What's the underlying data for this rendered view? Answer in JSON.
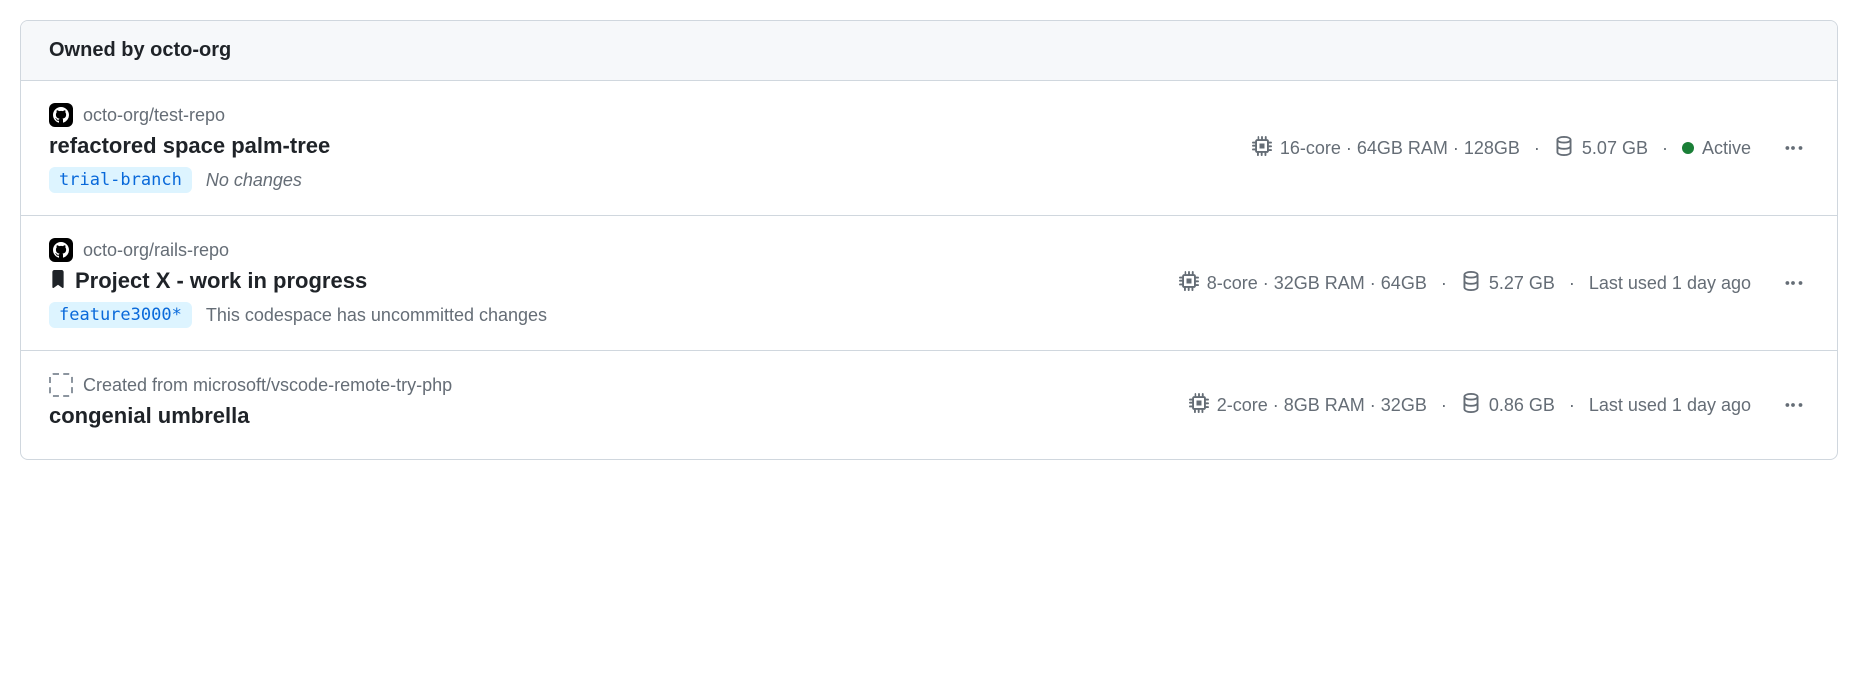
{
  "header": "Owned by octo-org",
  "items": [
    {
      "source_type": "repo",
      "repo_label": "octo-org/test-repo",
      "bookmarked": false,
      "name": "refactored space palm-tree",
      "branch": "trial-branch",
      "changes": "No changes",
      "changes_italic": true,
      "specs": "16-core · 64GB RAM · 128GB",
      "storage": "5.07 GB",
      "status_type": "active",
      "status_text": "Active"
    },
    {
      "source_type": "repo",
      "repo_label": "octo-org/rails-repo",
      "bookmarked": true,
      "name": "Project X - work in progress",
      "branch": "feature3000*",
      "changes": "This codespace has uncommitted changes",
      "changes_italic": false,
      "specs": "8-core · 32GB RAM · 64GB",
      "storage": "5.27 GB",
      "status_type": "last_used",
      "status_text": "Last used 1 day ago"
    },
    {
      "source_type": "template",
      "repo_label": "Created from microsoft/vscode-remote-try-php",
      "bookmarked": false,
      "name": "congenial umbrella",
      "branch": null,
      "changes": null,
      "changes_italic": false,
      "specs": "2-core · 8GB RAM · 32GB",
      "storage": "0.86 GB",
      "status_type": "last_used",
      "status_text": "Last used 1 day ago"
    }
  ]
}
